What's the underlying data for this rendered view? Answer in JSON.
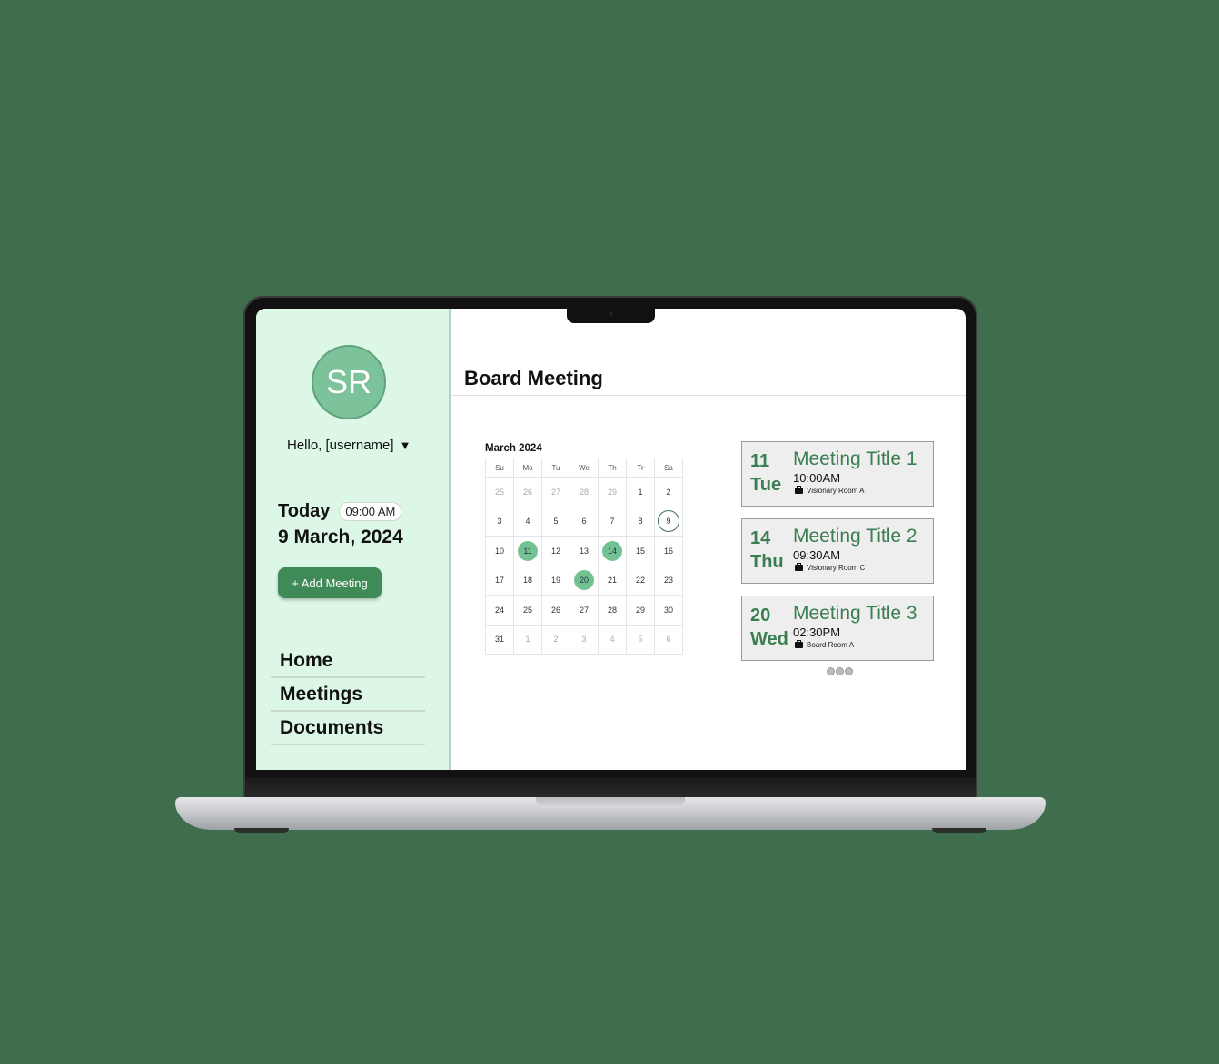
{
  "user": {
    "initials": "SR",
    "greeting": "Hello, [username]",
    "caret": "▼"
  },
  "today": {
    "label": "Today",
    "time": "09:00 AM",
    "date": "9 March, 2024"
  },
  "actions": {
    "add_meeting": "+ Add Meeting"
  },
  "nav": {
    "home": "Home",
    "meetings": "Meetings",
    "documents": "Documents"
  },
  "page": {
    "title": "Board Meeting"
  },
  "calendar": {
    "month_label": "March 2024",
    "weekdays": [
      "Su",
      "Mo",
      "Tu",
      "We",
      "Th",
      "Tr",
      "Sa"
    ],
    "weeks": [
      [
        "25",
        "26",
        "27",
        "28",
        "29",
        "1",
        "2"
      ],
      [
        "3",
        "4",
        "5",
        "6",
        "7",
        "8",
        "9"
      ],
      [
        "10",
        "11",
        "12",
        "13",
        "14",
        "15",
        "16"
      ],
      [
        "17",
        "18",
        "19",
        "20",
        "21",
        "22",
        "23"
      ],
      [
        "24",
        "25",
        "26",
        "27",
        "28",
        "29",
        "30"
      ],
      [
        "31",
        "1",
        "2",
        "3",
        "4",
        "5",
        "6"
      ]
    ],
    "selected_days": [
      "11",
      "14",
      "20"
    ],
    "today_day": "9"
  },
  "meetings": [
    {
      "day": "11",
      "weekday": "Tue",
      "title": "Meeting Title 1",
      "time": "10:00AM",
      "room": "Visionary Room A"
    },
    {
      "day": "14",
      "weekday": "Thu",
      "title": "Meeting Title 2",
      "time": "09:30AM",
      "room": "Visionary Room C"
    },
    {
      "day": "20",
      "weekday": "Wed",
      "title": "Meeting Title 3",
      "time": "02:30PM",
      "room": "Board Room A"
    }
  ],
  "colors": {
    "background": "#3f6e4f",
    "sidebar": "#dcf7e6",
    "accent": "#3f8a57",
    "highlight": "#74c294",
    "card_text": "#3a7e52"
  }
}
